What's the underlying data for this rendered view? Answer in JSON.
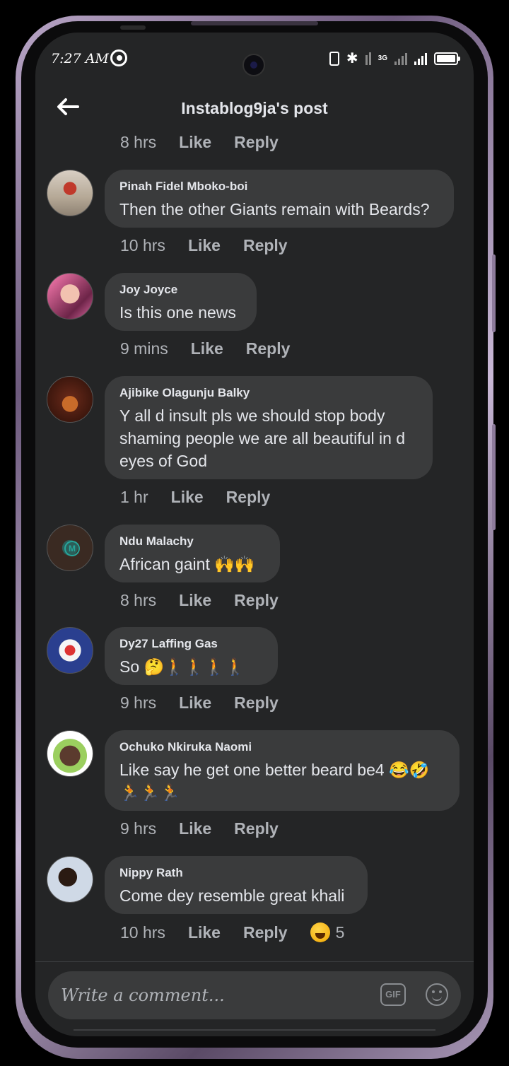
{
  "status_bar": {
    "time": "7:27 AM",
    "network": "3G"
  },
  "header": {
    "title": "Instablog9ja's post"
  },
  "top_meta": {
    "time": "8 hrs",
    "like": "Like",
    "reply": "Reply"
  },
  "comments": [
    {
      "name": "Pinah Fidel Mboko-boi",
      "text": "Then the other Giants remain with Beards?",
      "time": "10 hrs",
      "like": "Like",
      "reply": "Reply"
    },
    {
      "name": "Joy Joyce",
      "text": "Is this one news",
      "time": "9 mins",
      "like": "Like",
      "reply": "Reply"
    },
    {
      "name": "Ajibike Olagunju Balky",
      "text": "Y all d insult pls we should stop body shaming people we are all beautiful in d eyes of God",
      "time": "1 hr",
      "like": "Like",
      "reply": "Reply"
    },
    {
      "name": "Ndu Malachy",
      "text": "African gaint 🙌🙌",
      "time": "8 hrs",
      "like": "Like",
      "reply": "Reply"
    },
    {
      "name": "Dy27 Laffing Gas",
      "text": "So 🤔🚶🚶🚶🚶",
      "time": "9 hrs",
      "like": "Like",
      "reply": "Reply"
    },
    {
      "name": "Ochuko Nkiruka Naomi",
      "text": "Like say he get one better beard be4 😂🤣🏃🏃🏃",
      "time": "9 hrs",
      "like": "Like",
      "reply": "Reply"
    },
    {
      "name": "Nippy Rath",
      "text": "Come dey resemble great khali",
      "time": "10 hrs",
      "like": "Like",
      "reply": "Reply",
      "reaction_count": "5"
    }
  ],
  "composer": {
    "placeholder": "Write a comment...",
    "gif_label": "GIF"
  }
}
